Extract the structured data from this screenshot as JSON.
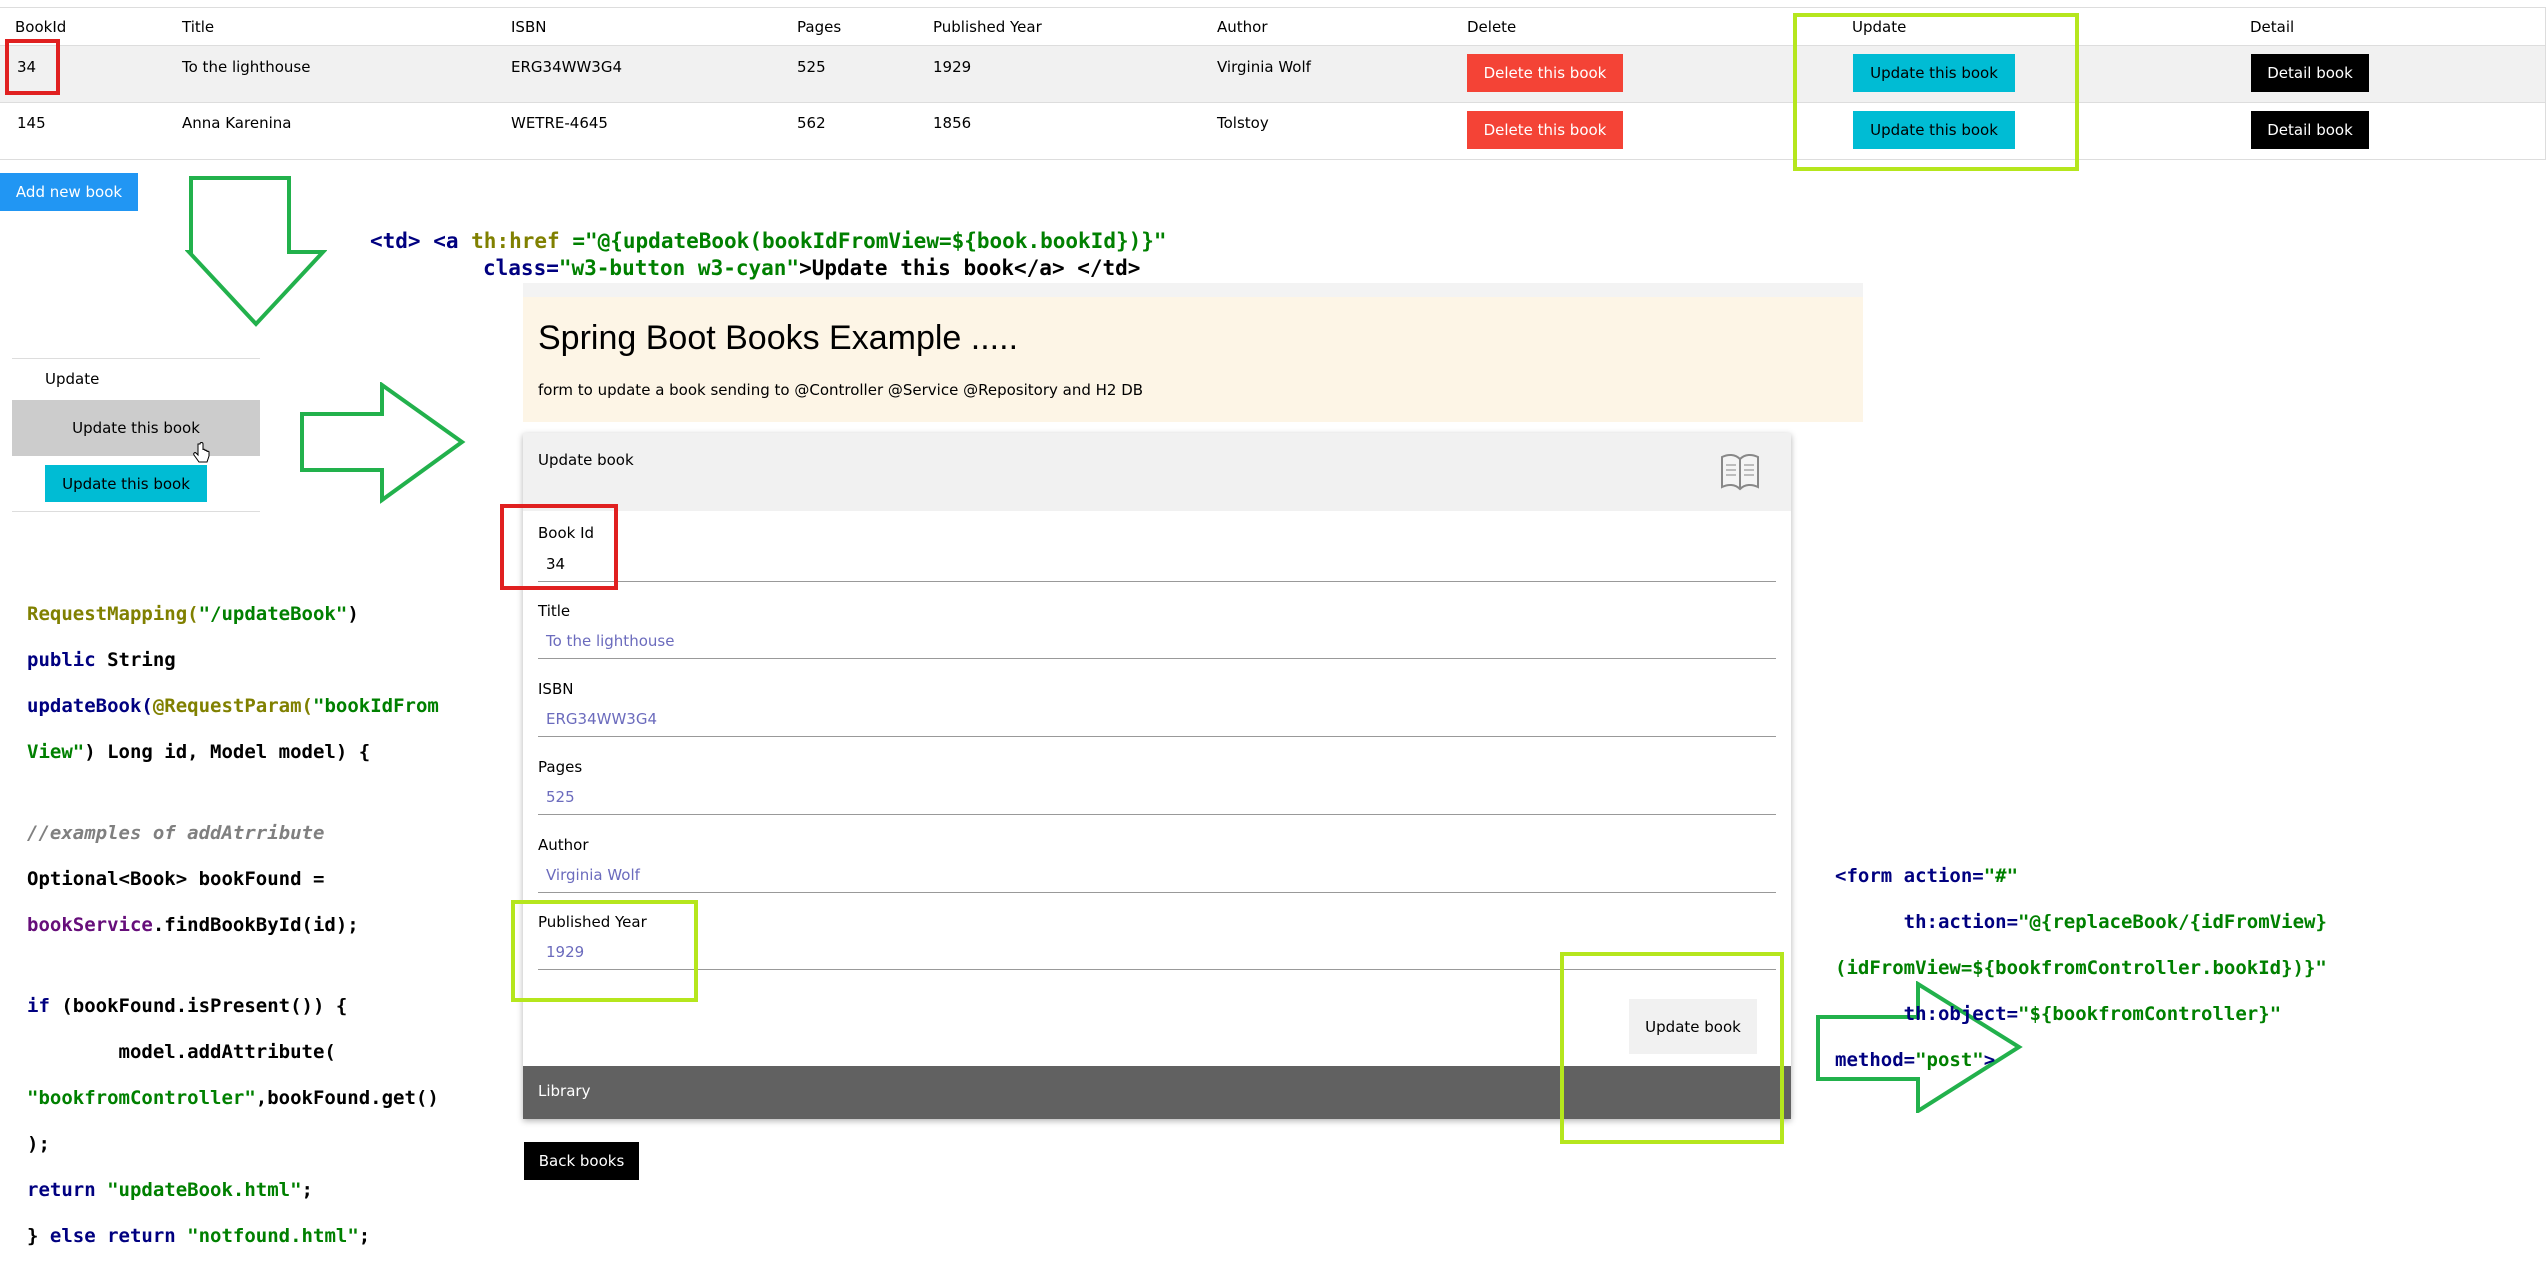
{
  "table": {
    "headers": [
      "BookId",
      "Title",
      "ISBN",
      "Pages",
      "Published Year",
      "Author",
      "Delete",
      "Update",
      "Detail"
    ],
    "rows": [
      {
        "id": "34",
        "title": "To the lighthouse",
        "isbn": "ERG34WW3G4",
        "pages": "525",
        "year": "1929",
        "author": "Virginia Wolf",
        "delete": "Delete this book",
        "update": "Update this book",
        "detail": "Detail book"
      },
      {
        "id": "145",
        "title": "Anna Karenina",
        "isbn": "WETRE-4645",
        "pages": "562",
        "year": "1856",
        "author": "Tolstoy",
        "delete": "Delete this book",
        "update": "Update this book",
        "detail": "Detail book"
      }
    ],
    "add_button": "Add new book"
  },
  "td_snippet": {
    "line1_a": "<td> <a ",
    "line1_b": "th:href",
    "line1_c": " =\"@{updateBook(bookIdFromView=${book.bookId})}\"",
    "line2_a": "class=",
    "line2_b": "\"w3-button w3-cyan\"",
    "line2_c": ">Update this book</a> </td>"
  },
  "zoom": {
    "header": "Update",
    "hover_button": "Update this book",
    "button": "Update this book"
  },
  "controller_code": {
    "l1_a": "RequestMapping(",
    "l1_b": "\"/updateBook\"",
    "l1_c": ")",
    "l2_a": "public ",
    "l2_b": "String",
    "l3_a": "updateBook(",
    "l3_b": "@RequestParam(",
    "l3_c": "\"bookIdFrom",
    "l4_a": "View\"",
    "l4_b": ") Long id, Model model) {",
    "l5": "//examples of addAtrribute",
    "l6": "Optional<Book> bookFound =",
    "l7_a": "bookService",
    "l7_b": ".findBookById(id);",
    "l8_a": "if",
    "l8_b": " (bookFound.isPresent()) {",
    "l9": "        model.addAttribute(",
    "l10_a": "\"bookfromController\"",
    "l10_b": ",bookFound.get()",
    "l11": ");",
    "l12_a": "return ",
    "l12_b": "\"updateBook.html\"",
    "l12_c": ";",
    "l13_a": "} ",
    "l13_b": "else return ",
    "l13_c": "\"notfound.html\"",
    "l13_d": ";"
  },
  "page": {
    "title": "Spring Boot Books Example .....",
    "subtitle": "form to update a book sending to @Controller @Service @Repository and H2 DB",
    "card_title": "Update book",
    "fields": [
      {
        "label": "Book Id",
        "value": "34"
      },
      {
        "label": "Title",
        "value": "To the lighthouse"
      },
      {
        "label": "ISBN",
        "value": "ERG34WW3G4"
      },
      {
        "label": "Pages",
        "value": "525"
      },
      {
        "label": "Author",
        "value": "Virginia Wolf"
      },
      {
        "label": "Published Year",
        "value": "1929"
      }
    ],
    "submit": "Update book",
    "footer": "Library",
    "back": "Back books"
  },
  "form_snippet": {
    "l1_a": "<form ",
    "l1_b": "action=",
    "l1_c": "\"#\"",
    "l2_a": "      th:action=",
    "l2_b": "\"@{replaceBook/{idFromView}",
    "l3": "(idFromView=${bookfromController.bookId})}\"",
    "l4_a": "      th:object=",
    "l4_b": "\"${bookfromController}\"",
    "l5_a": "method=",
    "l5_b": "\"post\"",
    "l5_c": ">"
  },
  "colors": {
    "highlight_red": "#e02020",
    "highlight_lime": "#b5e61d",
    "arrow_green": "#22b14c"
  }
}
